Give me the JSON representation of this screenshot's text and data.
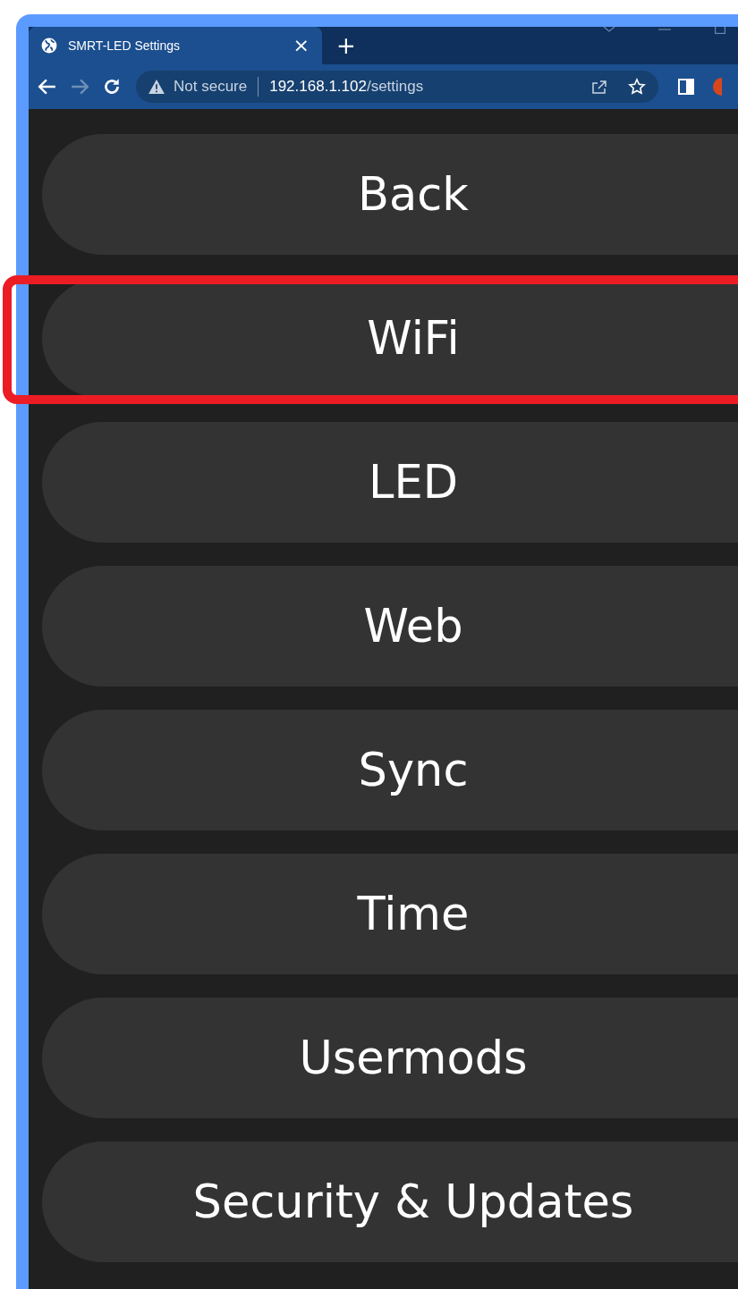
{
  "browser": {
    "tab_title": "SMRT-LED Settings",
    "tab_close": "×",
    "new_tab": "+",
    "security": "Not secure",
    "url_host": "192.168.1.102",
    "url_path": "/settings"
  },
  "menu": [
    {
      "label": "Back",
      "highlighted": false
    },
    {
      "label": "WiFi",
      "highlighted": true
    },
    {
      "label": "LED",
      "highlighted": false
    },
    {
      "label": "Web",
      "highlighted": false
    },
    {
      "label": "Sync",
      "highlighted": false
    },
    {
      "label": "Time",
      "highlighted": false
    },
    {
      "label": "Usermods",
      "highlighted": false
    },
    {
      "label": "Security & Updates",
      "highlighted": false
    }
  ]
}
